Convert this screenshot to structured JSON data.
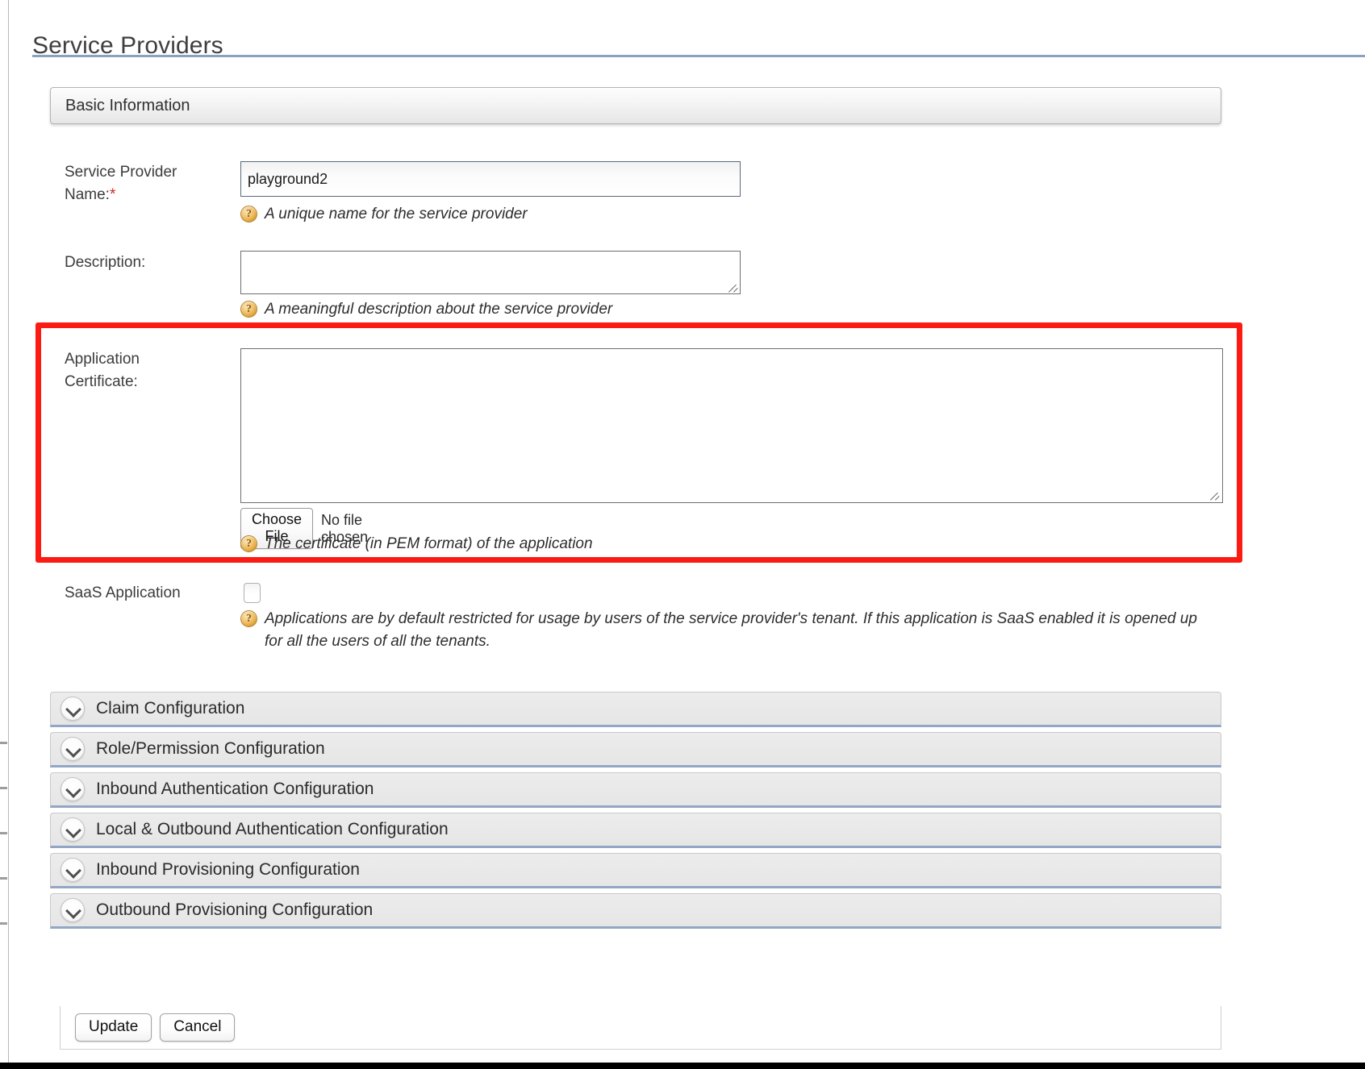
{
  "page": {
    "title": "Service Providers"
  },
  "panel": {
    "heading": "Basic Information"
  },
  "fields": {
    "service_provider_name": {
      "label": "Service Provider\nName:",
      "required_marker": "*",
      "value": "playground2",
      "hint": "A unique name for the service provider",
      "help_icon": "help-circle-icon"
    },
    "description": {
      "label": "Description:",
      "value": "",
      "hint": "A meaningful description about the service provider",
      "help_icon": "help-circle-icon"
    },
    "application_certificate": {
      "label": "Application\nCertificate:",
      "value": "",
      "choose_file_label": "Choose File",
      "file_status": "No file chosen",
      "hint": "The certificate (in PEM format) of the application",
      "help_icon": "help-circle-icon",
      "highlighted": true,
      "highlight_color": "#fb1b12"
    },
    "saas_application": {
      "label": "SaaS Application",
      "checked": false,
      "hint": "Applications are by default restricted for usage by users of the service provider's tenant. If this application is SaaS enabled it is opened up for all the users of all the tenants.",
      "help_icon": "help-circle-icon"
    }
  },
  "accordion": {
    "chevron_icon": "chevron-down-circle-icon",
    "items": [
      {
        "label": "Claim Configuration"
      },
      {
        "label": "Role/Permission Configuration"
      },
      {
        "label": "Inbound Authentication Configuration"
      },
      {
        "label": "Local & Outbound Authentication Configuration"
      },
      {
        "label": "Inbound Provisioning Configuration"
      },
      {
        "label": "Outbound Provisioning Configuration"
      }
    ]
  },
  "buttons": {
    "update": "Update",
    "cancel": "Cancel"
  },
  "colors": {
    "title_rule": "#8ca0c0",
    "required_star": "#d02a1f",
    "accordion_underline": "#93a6c4",
    "highlight": "#fb1b12",
    "help_icon": "#d99a2e"
  }
}
